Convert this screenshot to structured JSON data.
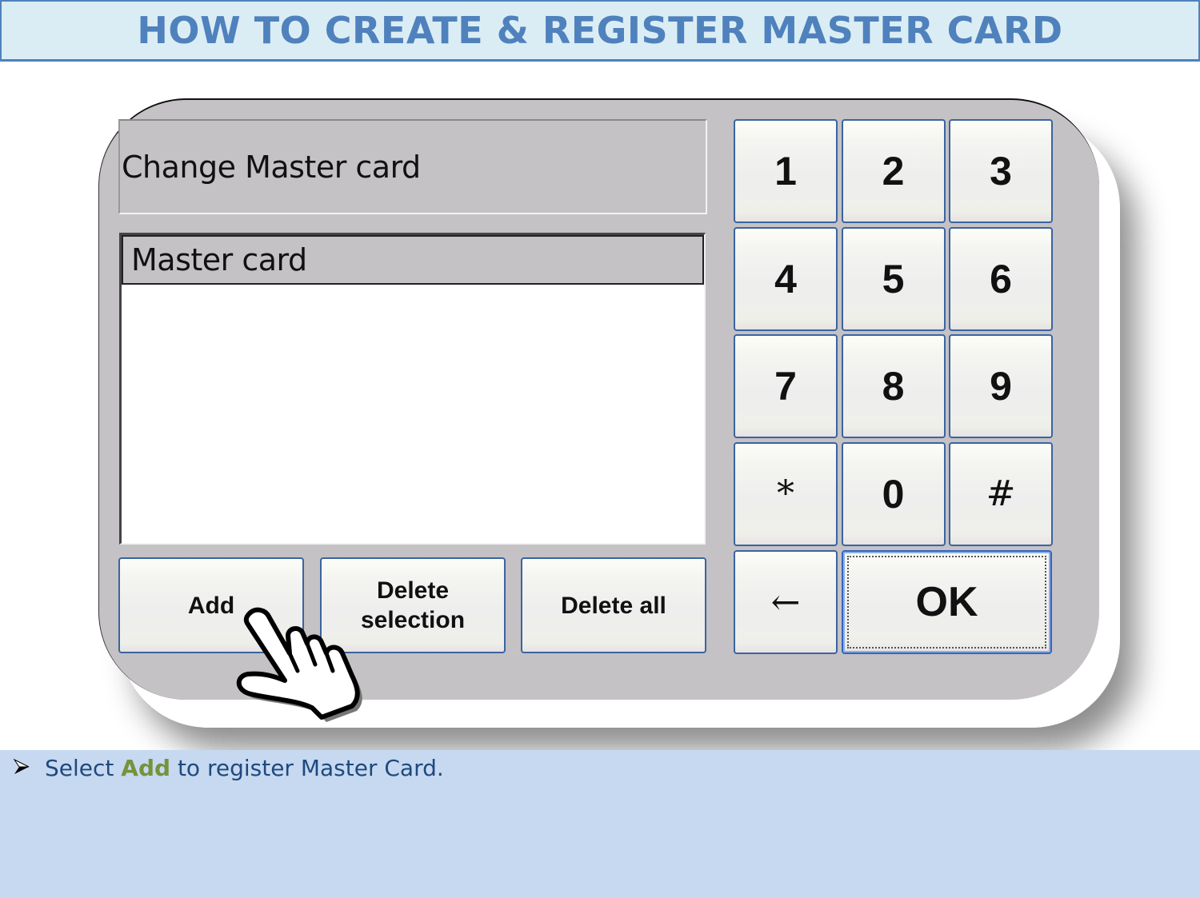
{
  "slide": {
    "title": "HOW TO CREATE & REGISTER MASTER CARD",
    "colors": {
      "title_text": "#4f81bd",
      "title_bg": "#dbedf4",
      "caption_bg": "#c6d9f0",
      "caption_text": "#1f497d",
      "caption_highlight": "#76923c",
      "panel_bg": "#c4c2c5",
      "button_border": "#3a64a0"
    }
  },
  "panel": {
    "header": "Change Master card",
    "list": {
      "items": [
        {
          "label": "Master card",
          "selected": true
        }
      ]
    },
    "actions": {
      "add": "Add",
      "delete_selection_line1": "Delete",
      "delete_selection_line2": "selection",
      "delete_all": "Delete all"
    },
    "keypad": {
      "keys": [
        "1",
        "2",
        "3",
        "4",
        "5",
        "6",
        "7",
        "8",
        "9",
        "*",
        "0",
        "#"
      ],
      "backspace": "←",
      "ok": "OK",
      "focused_key": "OK"
    },
    "pointer": {
      "icon": "pointing-hand-cursor",
      "target": "Add"
    }
  },
  "caption": {
    "bullet_icon": "arrowhead-bullet",
    "prefix": "Select ",
    "highlight": "Add",
    "suffix": " to register Master Card."
  }
}
